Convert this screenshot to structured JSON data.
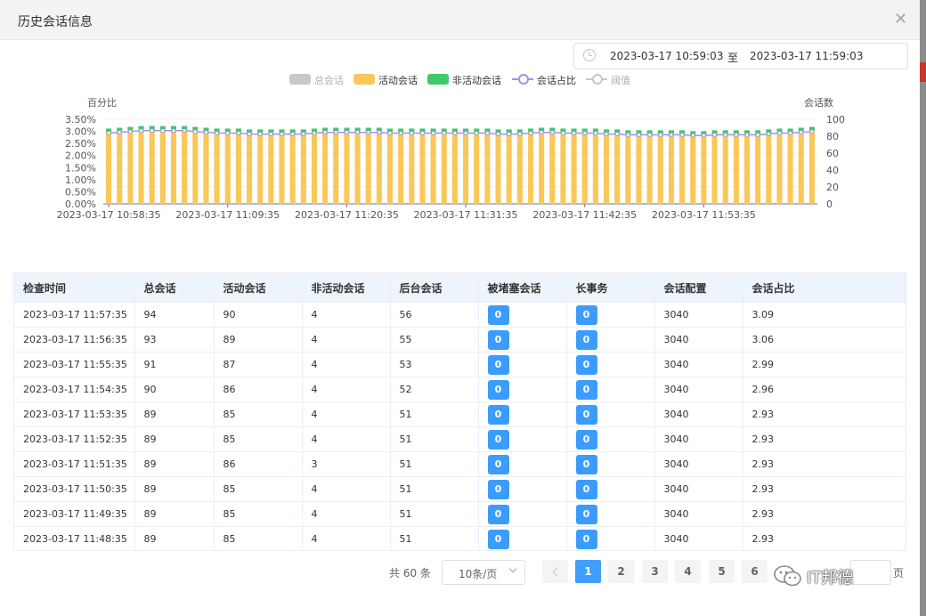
{
  "dialog": {
    "title": "历史会话信息",
    "close_icon": "close-icon"
  },
  "date_range": {
    "start": "2023-03-17 10:59:03",
    "separator": "至",
    "end": "2023-03-17 11:59:03",
    "icon": "clock-icon"
  },
  "legend": [
    {
      "label": "总会话",
      "type": "bar",
      "color": "#c8c8c8",
      "muted": true
    },
    {
      "label": "活动会话",
      "type": "bar",
      "color": "#fac858",
      "muted": false
    },
    {
      "label": "非活动会话",
      "type": "bar",
      "color": "#3ec96b",
      "muted": false
    },
    {
      "label": "会话占比",
      "type": "line",
      "color": "#9c95e8",
      "muted": false
    },
    {
      "label": "阈值",
      "type": "line",
      "color": "#c8c8c8",
      "muted": true
    }
  ],
  "chart_data": {
    "type": "bar",
    "title": "",
    "ylabel_left": "百分比",
    "ylabel_right": "会话数",
    "y_left_ticks": [
      "3.50%",
      "3.00%",
      "2.50%",
      "2.00%",
      "1.50%",
      "1.00%",
      "0.50%",
      "0.00%"
    ],
    "y_left_range": [
      0,
      3.5
    ],
    "y_right_ticks": [
      "100",
      "80",
      "60",
      "40",
      "20",
      "0"
    ],
    "y_right_range": [
      0,
      100
    ],
    "x_tick_labels": [
      "2023-03-17 10:58:35",
      "2023-03-17 11:09:35",
      "2023-03-17 11:20:35",
      "2023-03-17 11:31:35",
      "2023-03-17 11:42:35",
      "2023-03-17 11:53:35"
    ],
    "x_label_every": 11,
    "bar_width_ratio": 0.5,
    "series": [
      {
        "name": "活动会话",
        "stack": "sessions",
        "color": "#fac858",
        "values": [
          85,
          86,
          87,
          88,
          88,
          88,
          88,
          88,
          87,
          86,
          85,
          85,
          85,
          84,
          84,
          84,
          84,
          84,
          84,
          85,
          86,
          86,
          86,
          86,
          86,
          86,
          85,
          85,
          85,
          85,
          85,
          85,
          85,
          85,
          85,
          85,
          84,
          84,
          84,
          85,
          86,
          86,
          85,
          85,
          85,
          85,
          84,
          84,
          83,
          83,
          83,
          83,
          83,
          83,
          82,
          82,
          83,
          83,
          83,
          83,
          83,
          84,
          85,
          85,
          86,
          87
        ]
      },
      {
        "name": "非活动会话",
        "stack": "sessions",
        "color": "#3ec96b",
        "values": [
          4,
          4,
          4,
          4,
          4,
          4,
          4,
          4,
          4,
          4,
          4,
          4,
          4,
          4,
          4,
          4,
          4,
          4,
          4,
          4,
          4,
          4,
          4,
          4,
          4,
          4,
          4,
          4,
          4,
          4,
          4,
          4,
          4,
          4,
          4,
          4,
          4,
          4,
          4,
          4,
          4,
          4,
          4,
          4,
          4,
          4,
          4,
          4,
          4,
          4,
          4,
          4,
          4,
          4,
          4,
          4,
          4,
          4,
          4,
          4,
          4,
          4,
          4,
          4,
          4,
          4
        ]
      },
      {
        "name": "会话占比",
        "type": "line",
        "axis": "left",
        "color": "#9c95e8",
        "values": [
          2.93,
          2.96,
          2.99,
          3.03,
          3.03,
          3.03,
          3.03,
          3.03,
          2.99,
          2.96,
          2.93,
          2.93,
          2.93,
          2.89,
          2.89,
          2.89,
          2.89,
          2.89,
          2.89,
          2.93,
          2.96,
          2.96,
          2.96,
          2.96,
          2.96,
          2.96,
          2.93,
          2.93,
          2.93,
          2.93,
          2.93,
          2.93,
          2.93,
          2.93,
          2.93,
          2.93,
          2.89,
          2.89,
          2.89,
          2.93,
          2.96,
          2.96,
          2.93,
          2.93,
          2.93,
          2.93,
          2.89,
          2.89,
          2.86,
          2.86,
          2.86,
          2.86,
          2.86,
          2.86,
          2.83,
          2.83,
          2.86,
          2.86,
          2.86,
          2.86,
          2.86,
          2.89,
          2.93,
          2.93,
          2.96,
          2.99
        ]
      }
    ]
  },
  "table": {
    "columns": [
      "检查时间",
      "总会话",
      "活动会话",
      "非活动会话",
      "后台会话",
      "被堵塞会话",
      "长事务",
      "会话配置",
      "会话占比"
    ],
    "rows": [
      [
        "2023-03-17 11:57:35",
        "94",
        "90",
        "4",
        "56",
        "0",
        "0",
        "3040",
        "3.09"
      ],
      [
        "2023-03-17 11:56:35",
        "93",
        "89",
        "4",
        "55",
        "0",
        "0",
        "3040",
        "3.06"
      ],
      [
        "2023-03-17 11:55:35",
        "91",
        "87",
        "4",
        "53",
        "0",
        "0",
        "3040",
        "2.99"
      ],
      [
        "2023-03-17 11:54:35",
        "90",
        "86",
        "4",
        "52",
        "0",
        "0",
        "3040",
        "2.96"
      ],
      [
        "2023-03-17 11:53:35",
        "89",
        "85",
        "4",
        "51",
        "0",
        "0",
        "3040",
        "2.93"
      ],
      [
        "2023-03-17 11:52:35",
        "89",
        "85",
        "4",
        "51",
        "0",
        "0",
        "3040",
        "2.93"
      ],
      [
        "2023-03-17 11:51:35",
        "89",
        "86",
        "3",
        "51",
        "0",
        "0",
        "3040",
        "2.93"
      ],
      [
        "2023-03-17 11:50:35",
        "89",
        "85",
        "4",
        "51",
        "0",
        "0",
        "3040",
        "2.93"
      ],
      [
        "2023-03-17 11:49:35",
        "89",
        "85",
        "4",
        "51",
        "0",
        "0",
        "3040",
        "2.93"
      ],
      [
        "2023-03-17 11:48:35",
        "89",
        "85",
        "4",
        "51",
        "0",
        "0",
        "3040",
        "2.93"
      ]
    ]
  },
  "pagination": {
    "total": "共 60 条",
    "page_size": "10条/页",
    "pages": [
      "1",
      "2",
      "3",
      "4",
      "5",
      "6"
    ],
    "current": "1",
    "goto_suffix": "页"
  },
  "watermark": {
    "text": "IT邦德",
    "icon": "wechat-icon"
  }
}
